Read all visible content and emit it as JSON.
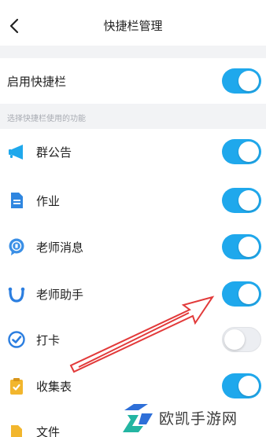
{
  "header": {
    "title": "快捷栏管理"
  },
  "master": {
    "label": "启用快捷栏",
    "enabled": true
  },
  "section": {
    "caption": "选择快捷栏使用的功能"
  },
  "items": [
    {
      "label": "群公告",
      "icon": "megaphone-icon",
      "enabled": true
    },
    {
      "label": "作业",
      "icon": "document-icon",
      "enabled": true
    },
    {
      "label": "老师消息",
      "icon": "teacher-message-icon",
      "enabled": true
    },
    {
      "label": "老师助手",
      "icon": "assistant-icon",
      "enabled": true
    },
    {
      "label": "打卡",
      "icon": "check-in-icon",
      "enabled": false
    },
    {
      "label": "收集表",
      "icon": "collection-form-icon",
      "enabled": true
    },
    {
      "label": "文件",
      "icon": "file-icon",
      "enabled": false
    }
  ],
  "watermark": {
    "text": "欧凯手游网"
  },
  "colors": {
    "accent": "#1fa8ec",
    "toggle_off": "#eceef2",
    "arrow": "#e23a3a",
    "section_bg": "#f2f3f5"
  }
}
